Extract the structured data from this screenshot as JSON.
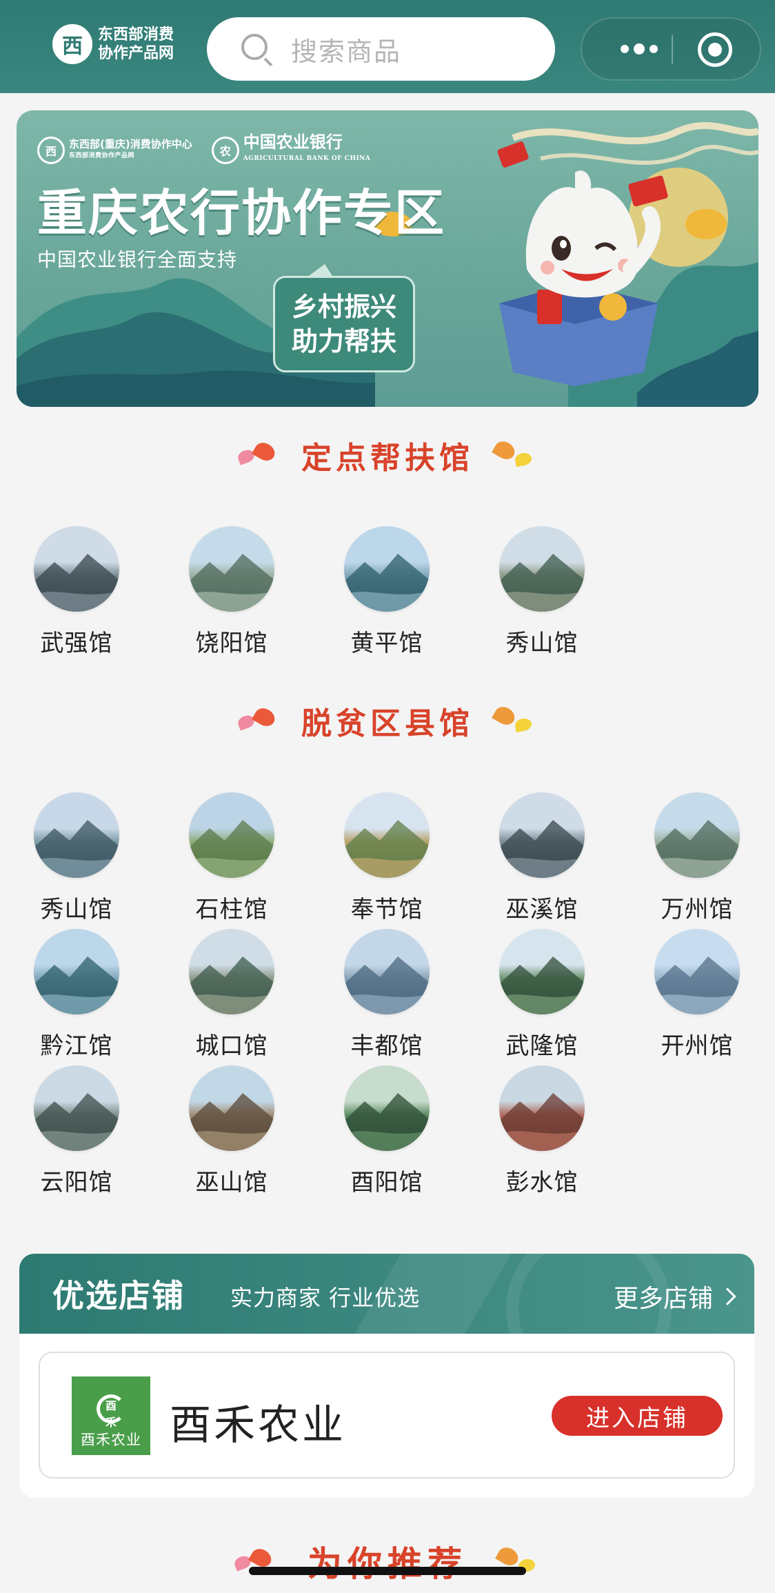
{
  "header": {
    "logo_mark": "西",
    "logo_line1": "东西部消费",
    "logo_line2": "协作产品网",
    "search_placeholder": "搜索商品"
  },
  "banner": {
    "partner1_name": "东西部(重庆)消费协作中心",
    "partner1_sub": "东西部消费协作产品网",
    "partner2_name": "中国农业银行",
    "partner2_sub": "AGRICULTURAL BANK OF CHINA",
    "title": "重庆农行协作专区",
    "subtitle": "中国农业银行全面支持",
    "bubble_line1": "乡村振兴",
    "bubble_line2": "助力帮扶"
  },
  "section_fixed": {
    "title": "定点帮扶馆",
    "items": [
      "武强馆",
      "饶阳馆",
      "黄平馆",
      "秀山馆"
    ]
  },
  "section_county": {
    "title": "脱贫区县馆",
    "items": [
      "秀山馆",
      "石柱馆",
      "奉节馆",
      "巫溪馆",
      "万州馆",
      "黔江馆",
      "城口馆",
      "丰都馆",
      "武隆馆",
      "开州馆",
      "云阳馆",
      "巫山馆",
      "酉阳馆",
      "彭水馆"
    ]
  },
  "shops": {
    "title": "优选店铺",
    "subtitle": "实力商家 行业优选",
    "more": "更多店铺",
    "item": {
      "logo_text": "酉禾农业",
      "logo_glyph": "酉禾",
      "name": "酉禾农业",
      "enter": "进入店铺"
    }
  },
  "recommend": {
    "title": "为你推荐"
  },
  "colors": {
    "brand": "#2f7a73",
    "accent": "#d8432a",
    "enter": "#d8302a"
  }
}
